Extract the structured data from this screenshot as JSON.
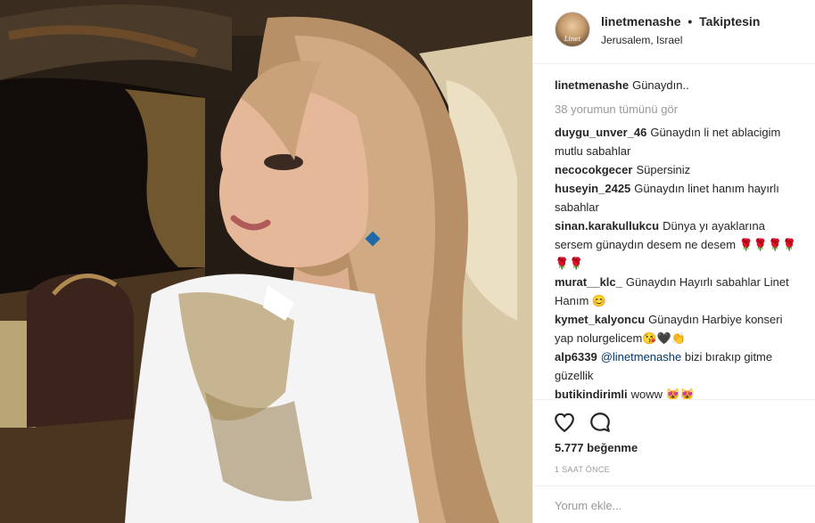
{
  "post": {
    "username": "linetmenashe",
    "separator": "•",
    "follow_status": "Takiptesin",
    "location": "Jerusalem, Israel",
    "avatar_caption": "Linet"
  },
  "caption": {
    "username": "linetmenashe",
    "text": "Günaydın.."
  },
  "view_all_comments": "38 yorumun tümünü gör",
  "comments": [
    {
      "username": "duygu_unver_46",
      "text": "Günaydın li net ablacigim mutlu sabahlar"
    },
    {
      "username": "necocokgecer",
      "text": "Süpersiniz"
    },
    {
      "username": "huseyin_2425",
      "text": "Günaydın linet hanım hayırlı sabahlar"
    },
    {
      "username": "sinan.karakullukcu",
      "text": "Dünya yı ayaklarına sersem günaydın desem ne desem 🌹🌹🌹🌹🌹🌹"
    },
    {
      "username": "murat__klc_",
      "text": "Günaydın Hayırlı sabahlar Linet Hanım 😊"
    },
    {
      "username": "kymet_kalyoncu",
      "text": "Günaydın Harbiye konseri yap nolurgelicem😘🖤👏"
    },
    {
      "username": "alp6339",
      "mention": "@linetmenashe",
      "text": "bizi bırakıp gitme güzellik"
    },
    {
      "username": "butikindirimli",
      "text": "woww 😻😻"
    }
  ],
  "actions": {
    "like_icon": "heart-icon",
    "comment_icon": "speech-bubble-icon"
  },
  "likes": "5.777 beğenme",
  "time_ago": "1 SAAT ÖNCE",
  "add_comment": {
    "placeholder": "Yorum ekle..."
  },
  "colors": {
    "text": "#262626",
    "muted": "#999999",
    "border": "#efefef",
    "mention": "#003569"
  }
}
